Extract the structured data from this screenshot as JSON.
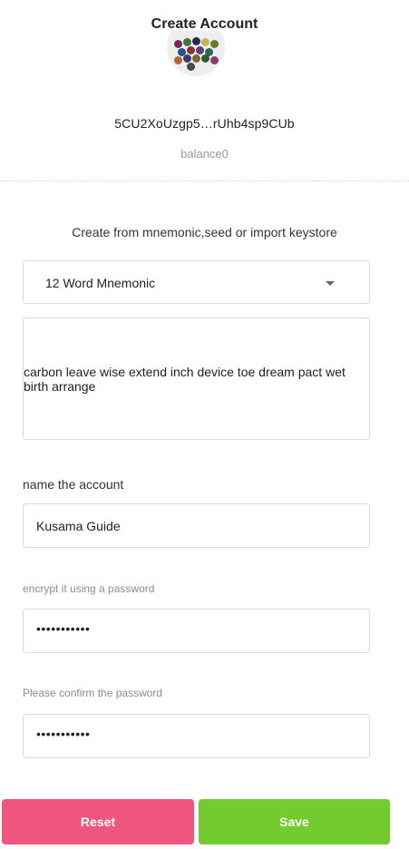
{
  "header": {
    "title": "Create Account"
  },
  "account": {
    "address": "5CU2XoUzgp5…rUhb4sp9CUb",
    "balance": "balance0"
  },
  "create": {
    "label": "Create from mnemonic,seed or import keystore",
    "type_select": {
      "selected": "12 Word Mnemonic"
    },
    "mnemonic": "carbon leave wise extend inch device toe dream pact wet birth arrange"
  },
  "form": {
    "name_label": "name the account",
    "name_value": "Kusama Guide",
    "password_label": "encrypt it using a password",
    "password_value": "•••••••••••",
    "confirm_label": "Please confirm the password",
    "confirm_value": "•••••••••••"
  },
  "actions": {
    "reset_label": "Reset",
    "save_label": "Save",
    "reset_color": "#f0557f",
    "save_color": "#73cc2f"
  },
  "identicon": {
    "icon": "polkadot-identicon",
    "colors": [
      "#7a2a5a",
      "#3f7a2a",
      "#1f2a57",
      "#c9b34b",
      "#6a7a2f",
      "#2a4f8a",
      "#8f2f35",
      "#5a3f7a",
      "#2a6a5a",
      "#b06a2f",
      "#3a3a7a",
      "#7a6a2a",
      "#2f5a2f",
      "#8a3a6a",
      "#4a4a4a"
    ]
  }
}
